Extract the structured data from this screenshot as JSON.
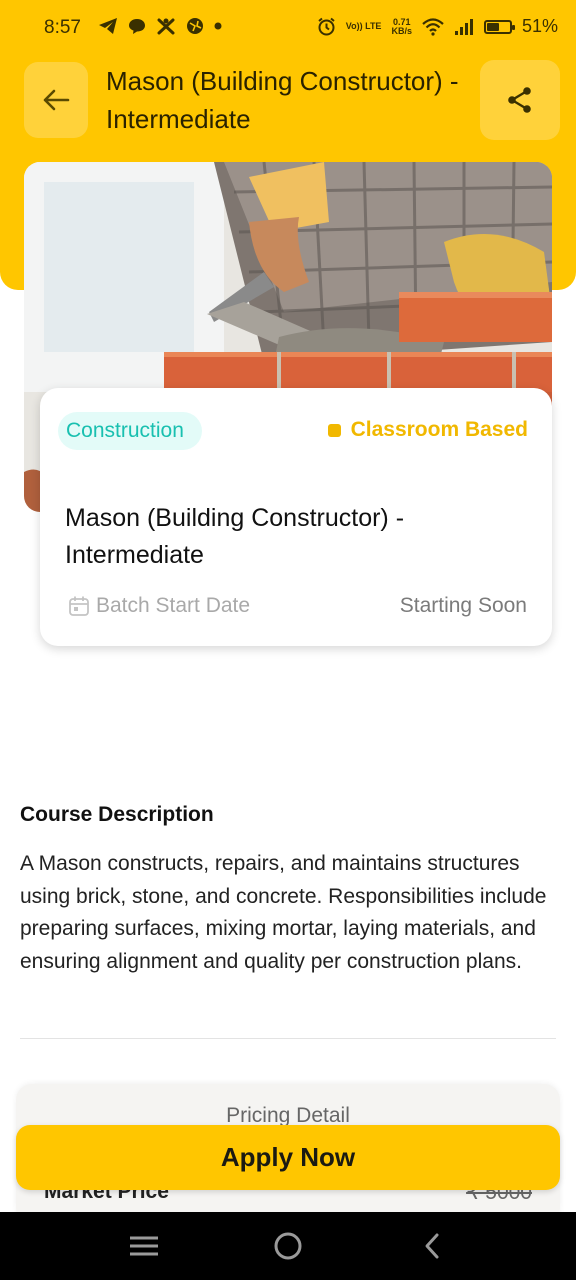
{
  "status_bar": {
    "time": "8:57",
    "volte": "Vo)) LTE",
    "speed_value": "0.71",
    "speed_unit": "KB/s",
    "battery_percent": "51%",
    "battery_level": 0.51
  },
  "header": {
    "title": "Mason (Building Constructor) - Intermediate",
    "back_icon": "arrow-left-icon",
    "share_icon": "share-icon"
  },
  "course_card": {
    "category": "Construction",
    "mode": "Classroom Based",
    "title": "Mason (Building Constructor) - Intermediate",
    "batch_label": "Batch Start Date",
    "batch_value": "Starting Soon"
  },
  "description": {
    "heading": "Course Description",
    "text": "A Mason constructs, repairs, and maintains structures using brick, stone, and concrete. Responsibilities include preparing surfaces, mixing mortar, laying materials, and ensuring alignment and quality per construction plans."
  },
  "pricing": {
    "title": "Pricing Detail",
    "market_label": "Market Price",
    "market_value": "₹ 5000"
  },
  "cta": {
    "label": "Apply Now"
  },
  "colors": {
    "brand_yellow": "#ffc600",
    "category_teal": "#19c0b0",
    "mode_yellow": "#f1b800"
  }
}
